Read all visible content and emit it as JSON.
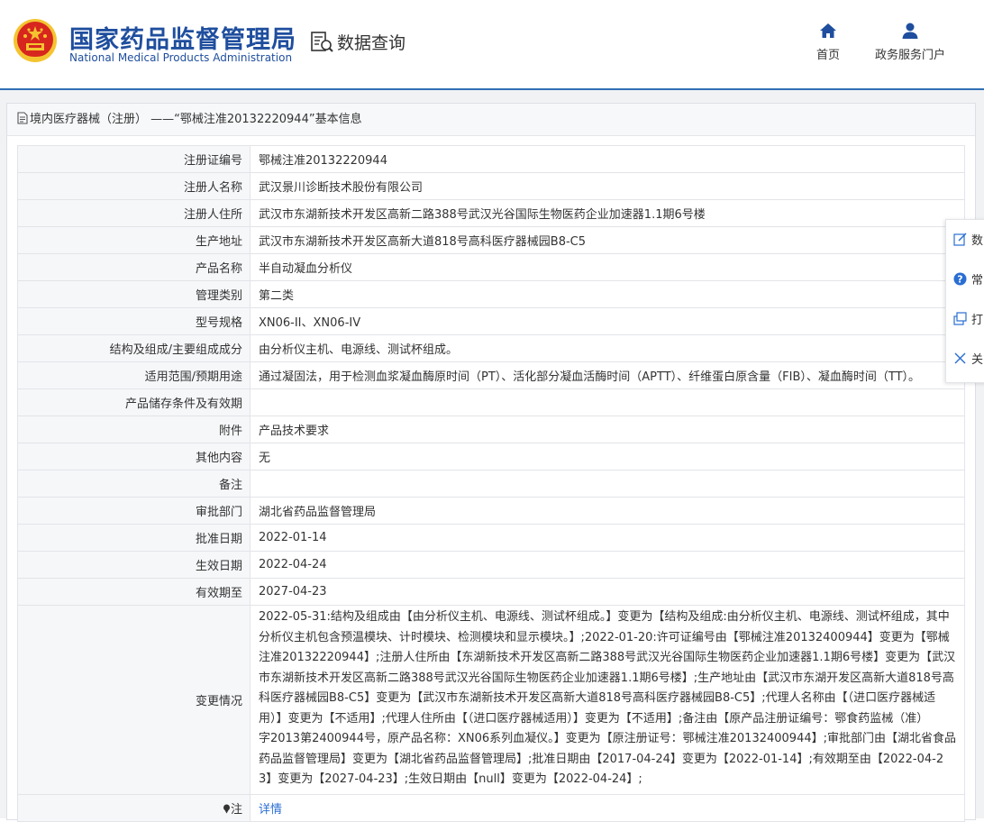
{
  "header": {
    "title_cn": "国家药品监督管理局",
    "title_en": "National Medical Products Administration",
    "query_label": "数据查询",
    "nav": [
      {
        "label": "首页",
        "icon": "home-icon"
      },
      {
        "label": "政务服务门户",
        "icon": "user-icon"
      }
    ]
  },
  "panel": {
    "title": "境内医疗器械（注册） ——“鄂械注准20132220944”基本信息"
  },
  "table": {
    "rows": [
      {
        "label": "注册证编号",
        "value": "鄂械注准20132220944"
      },
      {
        "label": "注册人名称",
        "value": "武汉景川诊断技术股份有限公司"
      },
      {
        "label": "注册人住所",
        "value": "武汉市东湖新技术开发区高新二路388号武汉光谷国际生物医药企业加速器1.1期6号楼"
      },
      {
        "label": "生产地址",
        "value": "武汉市东湖新技术开发区高新大道818号高科医疗器械园B8-C5"
      },
      {
        "label": "产品名称",
        "value": "半自动凝血分析仪"
      },
      {
        "label": "管理类别",
        "value": "第二类"
      },
      {
        "label": "型号规格",
        "value": "XN06-II、XN06-IV"
      },
      {
        "label": "结构及组成/主要组成成分",
        "value": "由分析仪主机、电源线、测试杯组成。"
      },
      {
        "label": "适用范围/预期用途",
        "value": "通过凝固法，用于检测血浆凝血酶原时间（PT）、活化部分凝血活酶时间（APTT）、纤维蛋白原含量（FIB）、凝血酶时间（TT）。"
      },
      {
        "label": "产品储存条件及有效期",
        "value": ""
      },
      {
        "label": "附件",
        "value": "产品技术要求"
      },
      {
        "label": "其他内容",
        "value": "无"
      },
      {
        "label": "备注",
        "value": ""
      },
      {
        "label": "审批部门",
        "value": "湖北省药品监督管理局"
      },
      {
        "label": "批准日期",
        "value": "2022-01-14"
      },
      {
        "label": "生效日期",
        "value": "2022-04-24"
      },
      {
        "label": "有效期至",
        "value": "2027-04-23"
      }
    ],
    "change_label": "变更情况",
    "change_lines": [
      "2022-05-31:结构及组成由【由分析仪主机、电源线、测试杯组成。】变更为【结构及组成:由分析仪主机、电源线、测试杯组成，其中",
      "分析仪主机包含预温模块、计时模块、检测模块和显示模块。】;2022-01-20:许可证编号由【鄂械注准20132400944】变更为【鄂械",
      "注准20132220944】;注册人住所由【东湖新技术开发区高新二路388号武汉光谷国际生物医药企业加速器1.1期6号楼】变更为【武汉",
      "市东湖新技术开发区高新二路388号武汉光谷国际生物医药企业加速器1.1期6号楼】;生产地址由【武汉市东湖开发区高新大道818号高",
      "科医疗器械园B8-C5】变更为【武汉市东湖新技术开发区高新大道818号高科医疗器械园B8-C5】;代理人名称由【（进口医疗器械适",
      "用）】变更为【不适用】;代理人住所由【（进口医疗器械适用）】变更为【不适用】;备注由【原产品注册证编号：鄂食药监械（准）",
      "字2013第2400944号，原产品名称：XN06系列血凝仪。】变更为【原注册证号：鄂械注准20132400944】;审批部门由【湖北省食品",
      "药品监督管理局】变更为【湖北省药品监督管理局】;批准日期由【2017-04-24】变更为【2022-01-14】;有效期至由【2022-04-2",
      "3】变更为【2027-04-23】;生效日期由【null】变更为【2022-04-24】;"
    ],
    "note_label": "注",
    "note_link": "详情"
  },
  "float_bar": {
    "items": [
      {
        "label": "数",
        "icon": "edit-icon"
      },
      {
        "label": "常",
        "icon": "help-icon"
      },
      {
        "label": "打",
        "icon": "print-icon"
      },
      {
        "label": "关",
        "icon": "close-icon"
      }
    ]
  },
  "colors": {
    "brand_blue": "#1f4e9e",
    "link_blue": "#2a6ed3",
    "emblem_red": "#d7261e",
    "emblem_gold": "#f4c430"
  }
}
